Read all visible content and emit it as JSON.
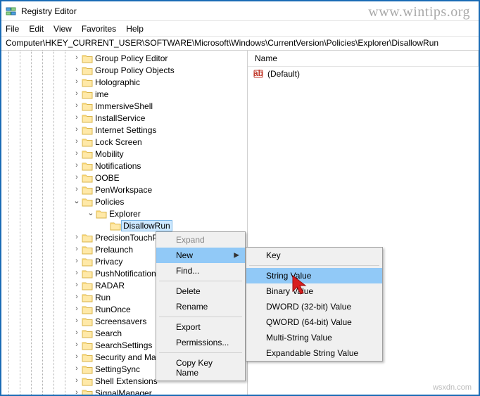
{
  "window": {
    "title": "Registry Editor"
  },
  "menubar": {
    "file": "File",
    "edit": "Edit",
    "view": "View",
    "favorites": "Favorites",
    "help": "Help"
  },
  "path": "Computer\\HKEY_CURRENT_USER\\SOFTWARE\\Microsoft\\Windows\\CurrentVersion\\Policies\\Explorer\\DisallowRun",
  "tree": {
    "nodes": [
      "Group Policy Editor",
      "Group Policy Objects",
      "Holographic",
      "ime",
      "ImmersiveShell",
      "InstallService",
      "Internet Settings",
      "Lock Screen",
      "Mobility",
      "Notifications",
      "OOBE",
      "PenWorkspace",
      "Policies",
      "Explorer",
      "DisallowRun",
      "PrecisionTouchPad",
      "Prelaunch",
      "Privacy",
      "PushNotifications",
      "RADAR",
      "Run",
      "RunOnce",
      "Screensavers",
      "Search",
      "SearchSettings",
      "Security and Maintenance",
      "SettingSync",
      "Shell Extensions",
      "SignalManager"
    ]
  },
  "values": {
    "header": {
      "name": "Name"
    },
    "default_label": "(Default)"
  },
  "ctx1": {
    "expand": "Expand",
    "new": "New",
    "find": "Find...",
    "delete": "Delete",
    "rename": "Rename",
    "export": "Export",
    "permissions": "Permissions...",
    "copykey": "Copy Key Name"
  },
  "ctx2": {
    "key": "Key",
    "string": "String Value",
    "binary": "Binary Value",
    "dword32": "DWORD (32-bit) Value",
    "qword64": "QWORD (64-bit) Value",
    "multistring": "Multi-String Value",
    "expstring": "Expandable String Value"
  },
  "watermark": "www.wintips.org",
  "watermark2": "wsxdn.com"
}
